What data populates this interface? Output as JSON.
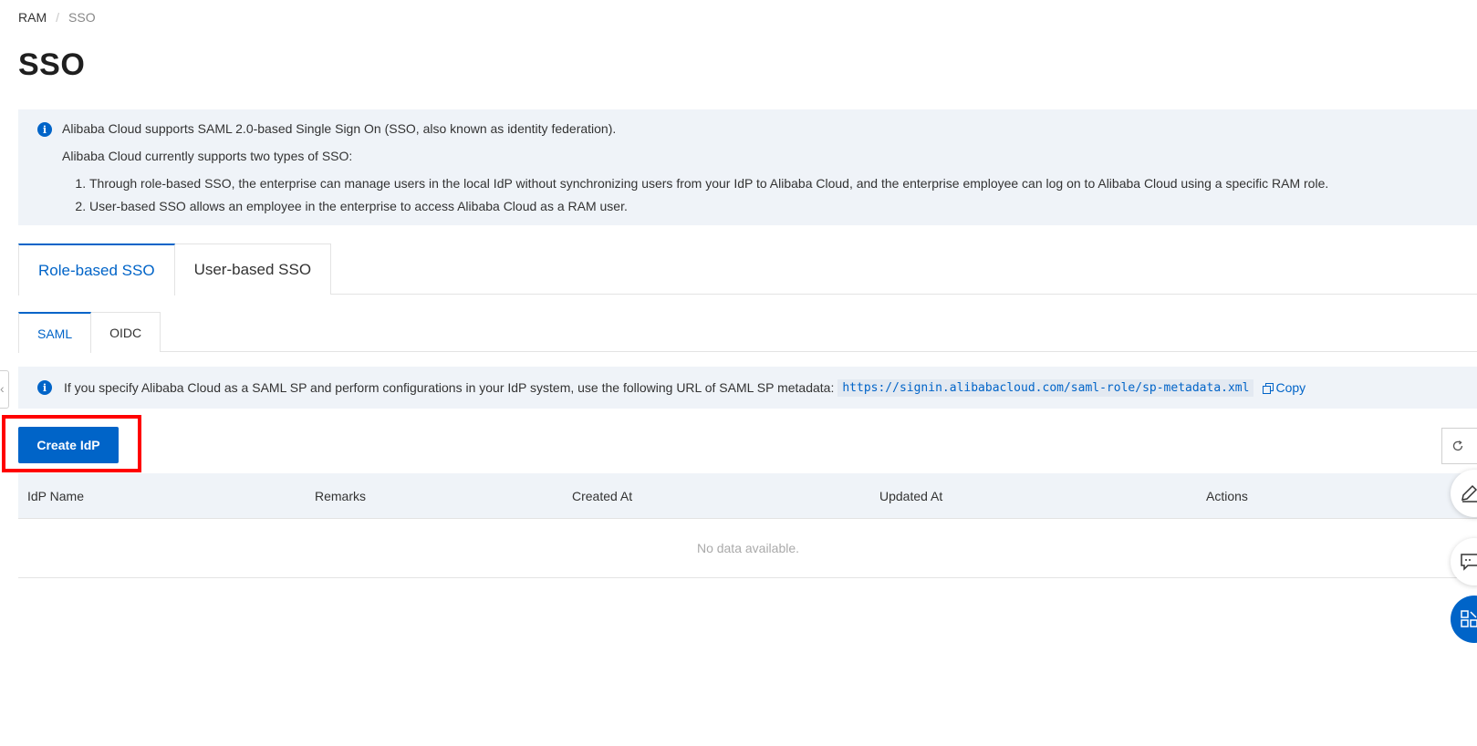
{
  "breadcrumb": {
    "root": "RAM",
    "separator": "/",
    "current": "SSO"
  },
  "page": {
    "title": "SSO"
  },
  "info": {
    "line1": "Alibaba Cloud supports SAML 2.0-based Single Sign On (SSO, also known as identity federation).",
    "line2": "Alibaba Cloud currently supports two types of SSO:",
    "items": [
      "Through role-based SSO, the enterprise can manage users in the local IdP without synchronizing users from your IdP to Alibaba Cloud, and the enterprise employee can log on to Alibaba Cloud using a specific RAM role.",
      "User-based SSO allows an employee in the enterprise to access Alibaba Cloud as a RAM user."
    ]
  },
  "tabs": {
    "main": [
      "Role-based SSO",
      "User-based SSO"
    ],
    "sub": [
      "SAML",
      "OIDC"
    ]
  },
  "sp_metadata": {
    "text": "If you specify Alibaba Cloud as a SAML SP and perform configurations in your IdP system, use the following URL of SAML SP metadata:",
    "url": "https://signin.alibabacloud.com/saml-role/sp-metadata.xml",
    "copy_label": "Copy"
  },
  "toolbar": {
    "create_label": "Create IdP"
  },
  "table": {
    "columns": [
      "IdP Name",
      "Remarks",
      "Created At",
      "Updated At",
      "Actions"
    ],
    "empty_text": "No data available."
  },
  "colors": {
    "accent": "#0064c8",
    "info_bg": "#eff3f8",
    "highlight": "#ff0000"
  },
  "icons": {
    "info": "info-icon",
    "copy": "copy-icon",
    "refresh": "refresh-icon",
    "edit": "edit-icon",
    "feedback": "feedback-icon",
    "apps": "apps-icon"
  }
}
